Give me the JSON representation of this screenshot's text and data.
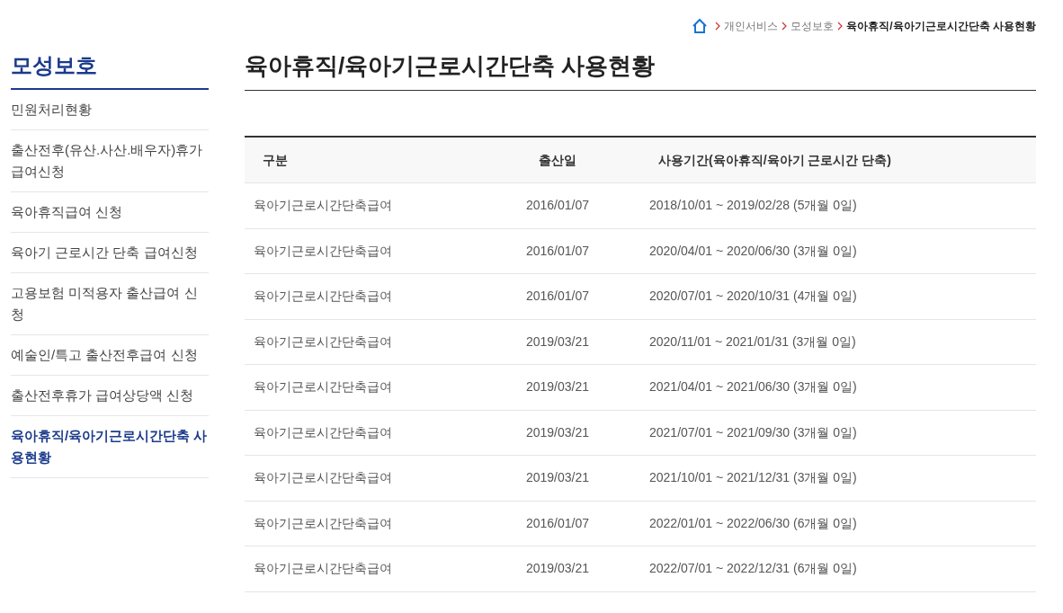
{
  "breadcrumb": [
    {
      "label": "개인서비스",
      "current": false
    },
    {
      "label": "모성보호",
      "current": false
    },
    {
      "label": "육아휴직/육아기근로시간단축 사용현황",
      "current": true
    }
  ],
  "sidebar": {
    "title": "모성보호",
    "items": [
      {
        "label": "민원처리현황",
        "selected": false
      },
      {
        "label": "출산전후(유산.사산.배우자)휴가 급여신청",
        "selected": false
      },
      {
        "label": "육아휴직급여 신청",
        "selected": false
      },
      {
        "label": "육아기 근로시간 단축 급여신청",
        "selected": false
      },
      {
        "label": "고용보험 미적용자 출산급여 신청",
        "selected": false
      },
      {
        "label": "예술인/특고 출산전후급여 신청",
        "selected": false
      },
      {
        "label": "출산전후휴가 급여상당액 신청",
        "selected": false
      },
      {
        "label": "육아휴직/육아기근로시간단축 사용현황",
        "selected": true
      }
    ]
  },
  "page_title": "육아휴직/육아기근로시간단축 사용현황",
  "table": {
    "columns": [
      "구분",
      "출산일",
      "사용기간(육아휴직/육아기 근로시간 단축)"
    ],
    "rows": [
      [
        "육아기근로시간단축급여",
        "2016/01/07",
        "2018/10/01 ~ 2019/02/28 (5개월 0일)"
      ],
      [
        "육아기근로시간단축급여",
        "2016/01/07",
        "2020/04/01 ~ 2020/06/30 (3개월 0일)"
      ],
      [
        "육아기근로시간단축급여",
        "2016/01/07",
        "2020/07/01 ~ 2020/10/31 (4개월 0일)"
      ],
      [
        "육아기근로시간단축급여",
        "2019/03/21",
        "2020/11/01 ~ 2021/01/31 (3개월 0일)"
      ],
      [
        "육아기근로시간단축급여",
        "2019/03/21",
        "2021/04/01 ~ 2021/06/30 (3개월 0일)"
      ],
      [
        "육아기근로시간단축급여",
        "2019/03/21",
        "2021/07/01 ~ 2021/09/30 (3개월 0일)"
      ],
      [
        "육아기근로시간단축급여",
        "2019/03/21",
        "2021/10/01 ~ 2021/12/31 (3개월 0일)"
      ],
      [
        "육아기근로시간단축급여",
        "2016/01/07",
        "2022/01/01 ~ 2022/06/30 (6개월 0일)"
      ],
      [
        "육아기근로시간단축급여",
        "2019/03/21",
        "2022/07/01 ~ 2022/12/31 (6개월 0일)"
      ]
    ]
  }
}
